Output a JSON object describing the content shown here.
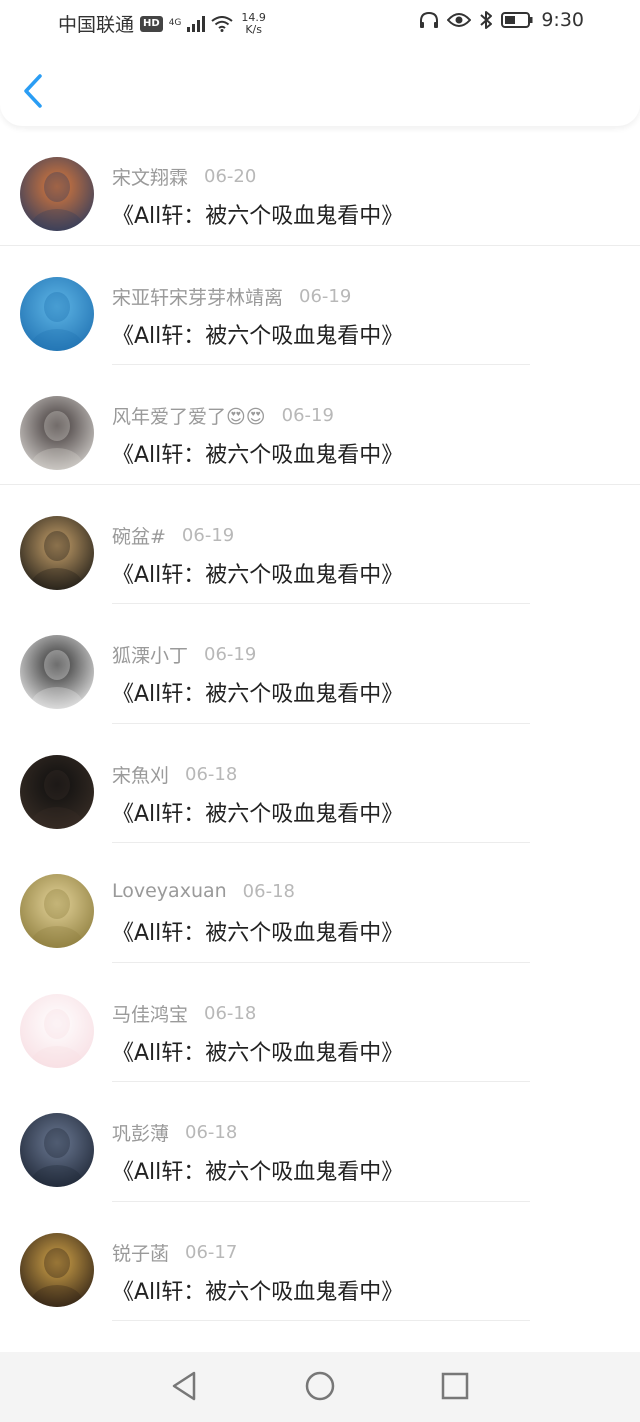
{
  "status_bar": {
    "carrier": "中国联通",
    "hd": "HD",
    "network": "4G",
    "speed_value": "14.9",
    "speed_unit": "K/s",
    "time": "9:30",
    "icons": [
      "headphones-icon",
      "eye-icon",
      "bluetooth-icon",
      "battery-icon",
      "wifi-icon",
      "signal-icon"
    ]
  },
  "header": {
    "back_icon": "chevron-left-icon"
  },
  "comments": [
    {
      "user": "宋文翔霖",
      "date": "06-20",
      "text": "《All轩：被六个吸血鬼看中》",
      "avatar_colors": [
        "#2b3a5e",
        "#e07b3a"
      ]
    },
    {
      "user": "宋亚轩宋芽芽林靖离",
      "date": "06-19",
      "text": "《All轩：被六个吸血鬼看中》",
      "avatar_colors": [
        "#1e6fb0",
        "#5fb6e6"
      ]
    },
    {
      "user": "风年爱了爱了😍😍",
      "date": "06-19",
      "text": "《All轩：被六个吸血鬼看中》",
      "avatar_colors": [
        "#d9d6d2",
        "#3b3333"
      ]
    },
    {
      "user": "碗盆#",
      "date": "06-19",
      "text": "《All轩：被六个吸血鬼看中》",
      "avatar_colors": [
        "#1a1814",
        "#c9a36c"
      ]
    },
    {
      "user": "狐溧小丁",
      "date": "06-19",
      "text": "《All轩：被六个吸血鬼看中》",
      "avatar_colors": [
        "#eeeeee",
        "#2a2a2a"
      ]
    },
    {
      "user": "宋魚刈",
      "date": "06-18",
      "text": "《All轩：被六个吸血鬼看中》",
      "avatar_colors": [
        "#3a2f27",
        "#0e0e0e"
      ]
    },
    {
      "user": "Loveyaxuan",
      "date": "06-18",
      "text": "《All轩：被六个吸血鬼看中》",
      "avatar_colors": [
        "#8a7a3a",
        "#e4d39a"
      ]
    },
    {
      "user": "马佳鸿宝",
      "date": "06-18",
      "text": "《All轩：被六个吸血鬼看中》",
      "avatar_colors": [
        "#f7dde2",
        "#ffffff"
      ]
    },
    {
      "user": "巩彭薄",
      "date": "06-18",
      "text": "《All轩：被六个吸血鬼看中》",
      "avatar_colors": [
        "#1c2433",
        "#6c7a94"
      ]
    },
    {
      "user": "锐子菡",
      "date": "06-17",
      "text": "《All轩：被六个吸血鬼看中》",
      "avatar_colors": [
        "#2a1d14",
        "#d4a64a"
      ]
    }
  ],
  "nav": {
    "icons": [
      "back-triangle-icon",
      "home-circle-icon",
      "recent-square-icon"
    ]
  },
  "colors": {
    "accent": "#2a9df4",
    "username": "#9a9a9a",
    "date": "#b8b8b8",
    "text": "#222222"
  }
}
